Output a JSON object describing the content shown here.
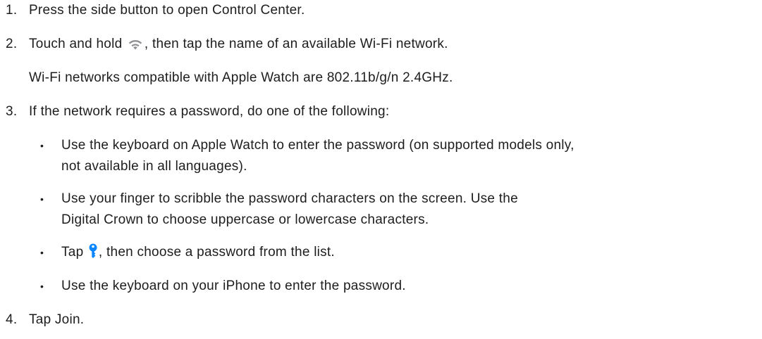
{
  "steps": [
    {
      "number": "1.",
      "text": "Press the side button to open Control Center."
    },
    {
      "number": "2.",
      "text_before": "Touch and hold ",
      "icon": "wifi-icon",
      "text_after": ", then tap the name of an available Wi-Fi network.",
      "note": "Wi-Fi networks compatible with Apple Watch are 802.11b/g/n 2.4GHz."
    },
    {
      "number": "3.",
      "text": "If the network requires a password, do one of the following:",
      "bullets": [
        {
          "line1": "Use the keyboard on Apple Watch to enter the password (on supported models only,",
          "line2": "not available in all languages)."
        },
        {
          "line1": "Use your finger to scribble the password characters on the screen. Use the",
          "line2": "Digital Crown to choose uppercase or lowercase characters."
        },
        {
          "text_before": "Tap ",
          "icon": "key-icon",
          "text_after": ", then choose a password from the list."
        },
        {
          "line1": "Use the keyboard on your iPhone to enter the password."
        }
      ]
    },
    {
      "number": "4.",
      "text": "Tap Join."
    }
  ],
  "bullet_char": "•",
  "colors": {
    "text": "#1d1d1f",
    "wifi_icon": "#8e8e93",
    "key_icon": "#0a84ff"
  }
}
